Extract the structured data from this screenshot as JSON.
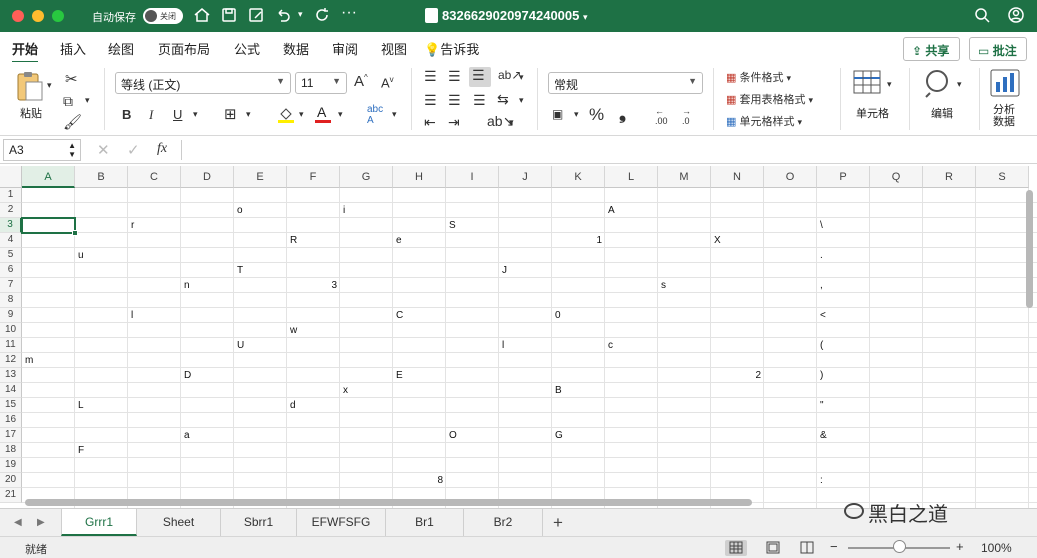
{
  "titlebar": {
    "autosave_label": "自动保存",
    "autosave_state": "关闭",
    "filename": "8326629020974240005",
    "bg_color": "#1e7145"
  },
  "ribbon_tabs": [
    "开始",
    "插入",
    "绘图",
    "页面布局",
    "公式",
    "数据",
    "审阅",
    "视图"
  ],
  "tell_me": "告诉我",
  "share_label": "共享",
  "comment_label": "批注",
  "ribbon": {
    "paste": "粘贴",
    "font_name": "等线 (正文)",
    "font_size": "11",
    "bold": "B",
    "italic": "I",
    "underline": "U",
    "number_format": "常规",
    "percent": "%",
    "comma": "❟",
    "decimal_inc": ".00",
    "decimal_dec": ".0",
    "conditional_format": "条件格式",
    "format_as_table": "套用表格格式",
    "cell_styles": "单元格样式",
    "cells": "单元格",
    "editing": "编辑",
    "analyze": "分析",
    "analyze2": "数据"
  },
  "formula_bar": {
    "name_box": "A3",
    "fx": "fx",
    "content": ""
  },
  "columns": [
    "A",
    "B",
    "C",
    "D",
    "E",
    "F",
    "G",
    "H",
    "I",
    "J",
    "K",
    "L",
    "M",
    "N",
    "O",
    "P",
    "Q",
    "R",
    "S"
  ],
  "rows": [
    "1",
    "2",
    "3",
    "4",
    "5",
    "6",
    "7",
    "8",
    "9",
    "10",
    "11",
    "12",
    "13",
    "14",
    "15",
    "16",
    "17",
    "18",
    "19",
    "20",
    "21"
  ],
  "selected_cell": {
    "col": "A",
    "row": 3
  },
  "cells": [
    {
      "col": 4,
      "row": 2,
      "v": "o"
    },
    {
      "col": 6,
      "row": 2,
      "v": "i"
    },
    {
      "col": 11,
      "row": 2,
      "v": "A"
    },
    {
      "col": 2,
      "row": 3,
      "v": "r"
    },
    {
      "col": 8,
      "row": 3,
      "v": "S"
    },
    {
      "col": 15,
      "row": 3,
      "v": "\\"
    },
    {
      "col": 5,
      "row": 4,
      "v": "R"
    },
    {
      "col": 7,
      "row": 4,
      "v": "e"
    },
    {
      "col": 10,
      "row": 4,
      "v": "1",
      "num": true
    },
    {
      "col": 13,
      "row": 4,
      "v": "X"
    },
    {
      "col": 1,
      "row": 5,
      "v": "u"
    },
    {
      "col": 15,
      "row": 5,
      "v": "."
    },
    {
      "col": 4,
      "row": 6,
      "v": "T"
    },
    {
      "col": 9,
      "row": 6,
      "v": "J"
    },
    {
      "col": 3,
      "row": 7,
      "v": "n"
    },
    {
      "col": 5,
      "row": 7,
      "v": "3",
      "num": true
    },
    {
      "col": 12,
      "row": 7,
      "v": "s"
    },
    {
      "col": 15,
      "row": 7,
      "v": ","
    },
    {
      "col": 2,
      "row": 9,
      "v": "l"
    },
    {
      "col": 7,
      "row": 9,
      "v": "C"
    },
    {
      "col": 10,
      "row": 9,
      "v": "0"
    },
    {
      "col": 15,
      "row": 9,
      "v": "<"
    },
    {
      "col": 5,
      "row": 10,
      "v": "w"
    },
    {
      "col": 4,
      "row": 11,
      "v": "U"
    },
    {
      "col": 9,
      "row": 11,
      "v": "l"
    },
    {
      "col": 11,
      "row": 11,
      "v": "c"
    },
    {
      "col": 15,
      "row": 11,
      "v": "("
    },
    {
      "col": 0,
      "row": 12,
      "v": "m"
    },
    {
      "col": 3,
      "row": 13,
      "v": "D"
    },
    {
      "col": 7,
      "row": 13,
      "v": "E"
    },
    {
      "col": 13,
      "row": 13,
      "v": "2",
      "num": true
    },
    {
      "col": 15,
      "row": 13,
      "v": ")"
    },
    {
      "col": 6,
      "row": 14,
      "v": "x"
    },
    {
      "col": 10,
      "row": 14,
      "v": "B"
    },
    {
      "col": 1,
      "row": 15,
      "v": "L"
    },
    {
      "col": 5,
      "row": 15,
      "v": "d"
    },
    {
      "col": 15,
      "row": 15,
      "v": "\""
    },
    {
      "col": 3,
      "row": 17,
      "v": "a"
    },
    {
      "col": 8,
      "row": 17,
      "v": "O"
    },
    {
      "col": 10,
      "row": 17,
      "v": "G"
    },
    {
      "col": 15,
      "row": 17,
      "v": "&"
    },
    {
      "col": 1,
      "row": 18,
      "v": "F"
    },
    {
      "col": 7,
      "row": 20,
      "v": "8",
      "num": true
    },
    {
      "col": 15,
      "row": 20,
      "v": ":"
    }
  ],
  "sheets": [
    "Grrr1",
    "Sheet",
    "Sbrr1",
    "EFWFSFG",
    "Br1",
    "Br2"
  ],
  "active_sheet": "Grrr1",
  "watermark": "黑白之道",
  "status": {
    "ready": "就绪",
    "zoom": "100%"
  }
}
